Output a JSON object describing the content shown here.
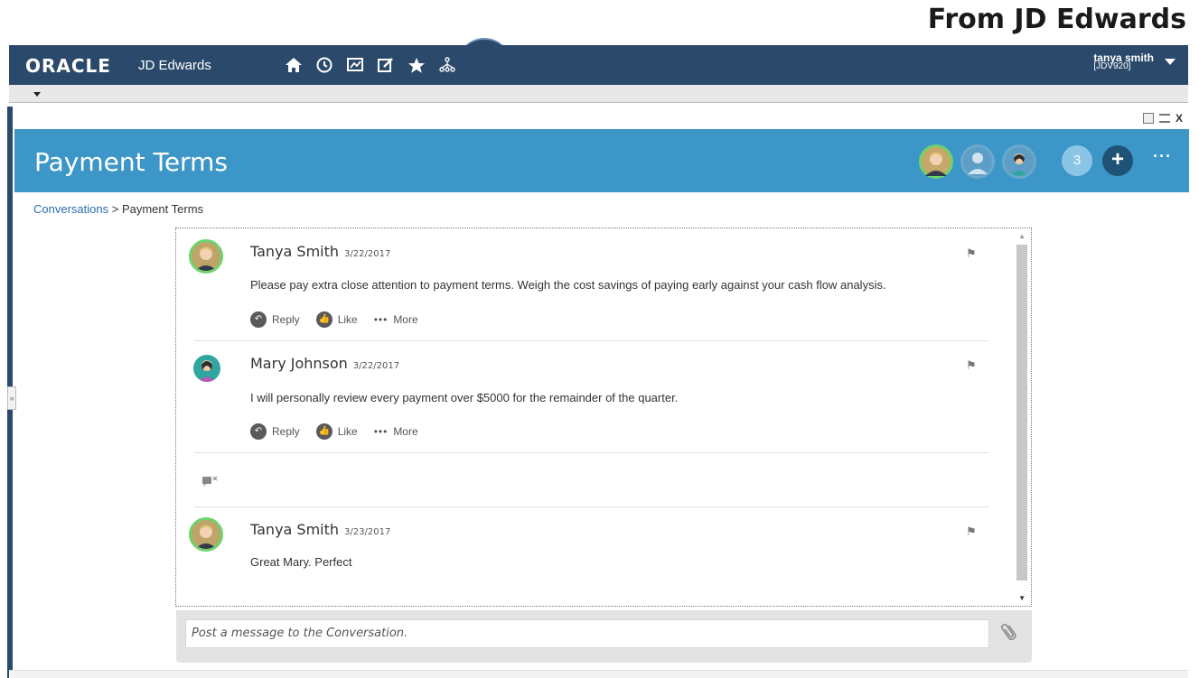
{
  "caption": "From JD Edwards",
  "topbar": {
    "logo": "ORACLE",
    "logo_sub": "JD Edwards",
    "user_name": "tanya smith",
    "user_env": "[JDV920]",
    "nav_icons": [
      "home-icon",
      "recent-icon",
      "analytics-icon",
      "edit-icon",
      "favorites-star-icon",
      "hierarchy-icon"
    ]
  },
  "header": {
    "title": "Payment Terms",
    "participant_count": "3",
    "add_label": "+",
    "more_label": "···"
  },
  "breadcrumb": {
    "link": "Conversations",
    "separator": ">",
    "current": "Payment Terms"
  },
  "messages": [
    {
      "author": "Tanya Smith",
      "date": "3/22/2017",
      "text": "Please pay extra close attention to payment terms.  Weigh the cost savings of paying early against your cash flow analysis.",
      "reply": "Reply",
      "like": "Like",
      "more": "More"
    },
    {
      "author": "Mary Johnson",
      "date": "3/22/2017",
      "text": "I will personally review every payment over $5000 for the remainder of the quarter.",
      "reply": "Reply",
      "like": "Like",
      "more": "More"
    },
    {
      "author": "Tanya Smith",
      "date": "3/23/2017",
      "text": "Great Mary.  Perfect"
    }
  ],
  "composer": {
    "placeholder": "Post a message to the Conversation."
  },
  "window_tools": {
    "close_label": "X"
  }
}
